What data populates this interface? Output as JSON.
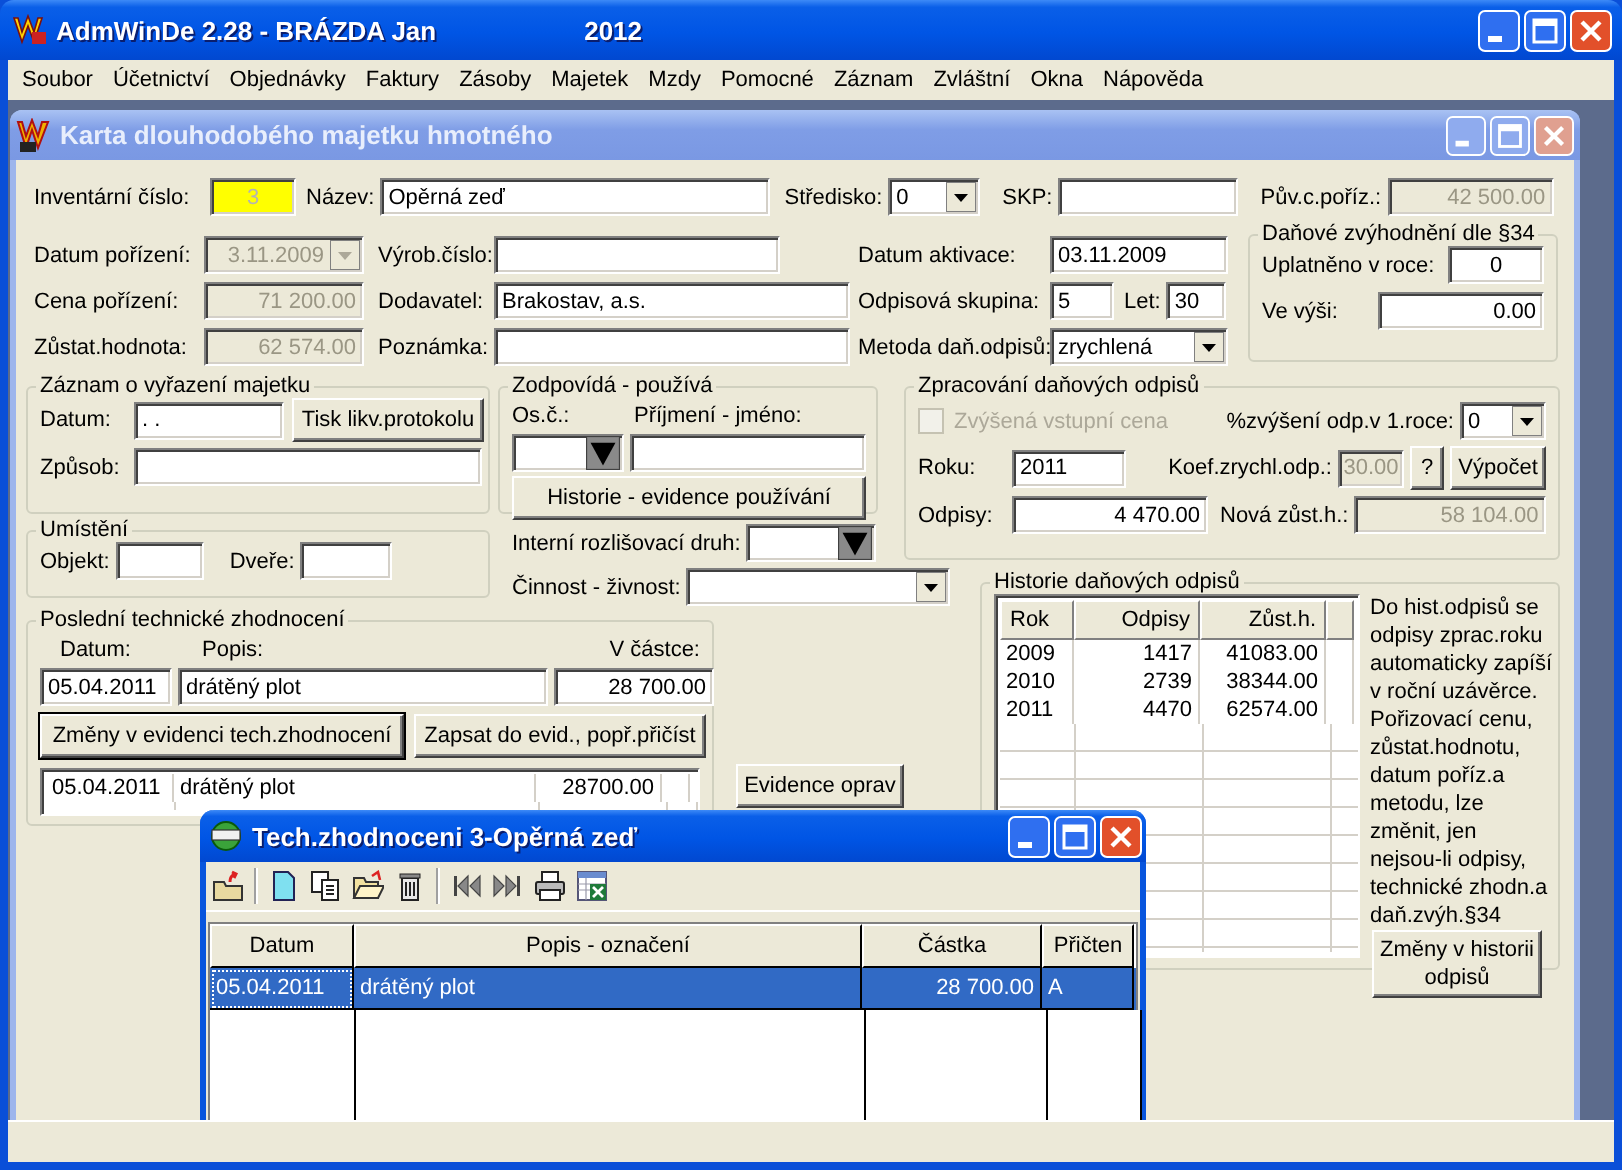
{
  "window": {
    "title": "AdmWinDe 2.28 - BRÁZDA Jan",
    "year": "2012"
  },
  "menu": [
    "Soubor",
    "Účetnictví",
    "Objednávky",
    "Faktury",
    "Zásoby",
    "Majetek",
    "Mzdy",
    "Pomocné",
    "Záznam",
    "Zvláštní",
    "Okna",
    "Nápověda"
  ],
  "card": {
    "title": "Karta dlouhodobého majetku hmotného",
    "inventory_no": {
      "label": "Inventární číslo:",
      "value": "3",
      "highlighted": true
    },
    "name": {
      "label": "Název:",
      "value": "Opěrná zeď"
    },
    "cost_center": {
      "label": "Středisko:",
      "value": "0",
      "kind": "combo"
    },
    "skp": {
      "label": "SKP:"
    },
    "original_price": {
      "label": "Pův.c.poříz.:",
      "value": "42 500.00",
      "disabled": true
    },
    "acquired_date": {
      "label": "Datum pořízení:",
      "value": "3.11.2009",
      "kind": "combo",
      "disabled": true
    },
    "serial_no": {
      "label": "Výrob.číslo:"
    },
    "activation_date": {
      "label": "Datum aktivace:",
      "value": "03.11.2009"
    },
    "price": {
      "label": "Cena pořízení:",
      "value": "71 200.00",
      "disabled": true
    },
    "supplier": {
      "label": "Dodavatel:",
      "value": "Brakostav, a.s."
    },
    "depreciation_group": {
      "label": "Odpisová skupina:",
      "value": "5"
    },
    "years": {
      "label": "Let:",
      "value": "30"
    },
    "residual_value": {
      "label": "Zůstat.hodnota:",
      "value": "62 574.00",
      "disabled": true
    },
    "note": {
      "label": "Poznámka:"
    },
    "method": {
      "label": "Metoda daň.odpisů:",
      "value": "zrychlená",
      "kind": "combo"
    },
    "tax_benefit": {
      "title": "Daňové zvýhodnění dle §34",
      "year": {
        "label": "Uplatněno v roce:",
        "value": "0"
      },
      "amount": {
        "label": "Ve výši:",
        "value": "0.00"
      }
    },
    "disposal": {
      "title": "Záznam o vyřazení majetku",
      "date": {
        "label": "Datum:",
        "value": ". ."
      },
      "print_button": "Tisk likv.protokolu",
      "method": {
        "label": "Způsob:"
      }
    },
    "responsible": {
      "title": "Zodpovídá - používá",
      "person_no": {
        "label": "Os.č.:",
        "kind": "dark-combo"
      },
      "person_name": {
        "label": "Příjmení - jméno:"
      },
      "history_button": "Historie - evidence používání"
    },
    "location": {
      "title": "Umístění",
      "building": {
        "label": "Objekt:"
      },
      "door": {
        "label": "Dveře:"
      }
    },
    "internal_type": {
      "label": "Interní rozlišovací druh:",
      "kind": "dark-combo"
    },
    "activity": {
      "label": "Činnost - živnost:",
      "kind": "combo"
    },
    "last_improvement": {
      "title": "Poslední technické zhodnocení",
      "date": {
        "label": "Datum:",
        "value": "05.04.2011"
      },
      "description": {
        "label": "Popis:",
        "value": "drátěný plot"
      },
      "amount": {
        "label": "V částce:",
        "value": "28 700.00"
      },
      "buttons": [
        {
          "label": "Změny v evidenci tech.zhodnocení",
          "default": true
        },
        {
          "label": "Zapsat do evid., popř.přičíst",
          "default": false
        }
      ],
      "rows": [
        [
          "05.04.2011",
          "drátěný plot",
          "28700.00"
        ]
      ]
    },
    "repairs_button": "Evidence oprav",
    "tax_processing": {
      "title": "Zpracování daňových odpisů",
      "raised_price": {
        "label": "Zvýšená vstupní cena",
        "checked": false,
        "disabled": true
      },
      "first_year_increase": {
        "label": "%zvýšení odp.v 1.roce:",
        "value": "0",
        "kind": "combo"
      },
      "year": {
        "label": "Roku:",
        "value": "2011"
      },
      "coefficient": {
        "label": "Koef.zrychl.odp.:",
        "value": "30.00",
        "disabled": true
      },
      "help_button": "?",
      "calc_button": "Výpočet",
      "depreciation": {
        "label": "Odpisy:",
        "value": "4 470.00"
      },
      "new_residual": {
        "label": "Nová zůst.h.:",
        "value": "58 104.00",
        "disabled": true
      }
    },
    "history": {
      "title": "Historie daňových odpisů",
      "columns": [
        "Rok",
        "Odpisy",
        "Zůst.h."
      ],
      "rows": [
        [
          "2009",
          "1417",
          "41083.00"
        ],
        [
          "2010",
          "2739",
          "38344.00"
        ],
        [
          "2011",
          "4470",
          "62574.00"
        ]
      ],
      "note": "Do hist.odpisů se odpisy zprac.roku automaticky zapíší v roční uzávěrce. Pořizovací cenu, zůstat.hodnotu, datum poříz.a metodu, lze změnit, jen nejsou-li odpisy, technické zhodn.a daň.zvýh.§34",
      "button": "Změny v historii odpisů"
    }
  },
  "dialog": {
    "title": "Tech.zhodnoceni 3-Opěrná zeď",
    "columns": [
      "Datum",
      "Popis - označení",
      "Částka",
      "Přičten"
    ],
    "rows": [
      {
        "cells": [
          "05.04.2011",
          "drátěný plot",
          "28 700.00",
          "A"
        ],
        "selected": true
      }
    ]
  }
}
